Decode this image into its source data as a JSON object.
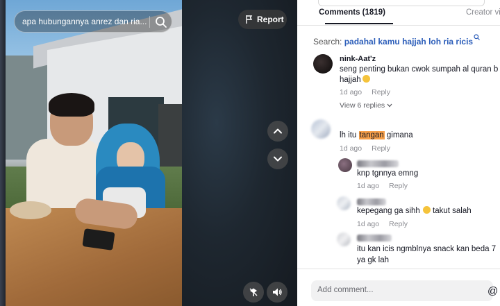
{
  "video": {
    "search_query": "apa hubungannya anrez dan ria...",
    "report_label": "Report"
  },
  "comments_panel": {
    "tabs": {
      "comments_label": "Comments (1819)",
      "creator_label": "Creator vid"
    },
    "search_suggestion": {
      "prefix": "Search: ",
      "query": "padahal kamu hajjah loh ria ricis"
    },
    "comments": [
      {
        "username": "nink-Aat'z",
        "text_line1": "seng penting bukan cwok sumpah al quran b",
        "text_line2": "hajjah",
        "time": "1d ago",
        "reply_label": "Reply",
        "view_replies": "View 6 replies"
      },
      {
        "text_before": "lh itu ",
        "text_highlight": "tangan",
        "text_after": " gimana",
        "time": "1d ago",
        "reply_label": "Reply",
        "replies": [
          {
            "text": "knp tgnnya emng",
            "time": "1d ago",
            "reply_label": "Reply"
          },
          {
            "text": "kepegang ga sihh",
            "text_after": " takut salah",
            "time": "1d ago",
            "reply_label": "Reply"
          },
          {
            "text_line1": "itu kan icis ngmblnya snack kan beda 7",
            "text_line2": "ya gk lah"
          }
        ]
      }
    ],
    "add_comment_placeholder": "Add comment...",
    "mention_symbol": "@"
  },
  "colors": {
    "highlight": "#f7a04a",
    "link": "#2b5db9"
  }
}
